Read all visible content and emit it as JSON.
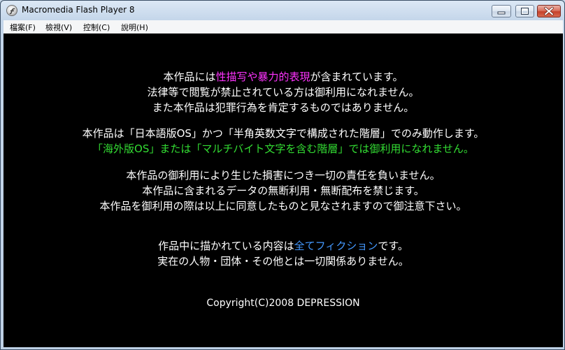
{
  "window": {
    "title": "Macromedia Flash Player 8"
  },
  "menu": {
    "items": [
      "檔案(F)",
      "檢視(V)",
      "控制(C)",
      "說明(H)"
    ]
  },
  "colors": {
    "text": "#ffffff",
    "highlight_magenta": "#ff33ff",
    "highlight_green": "#33dd33",
    "highlight_blue": "#4499ff",
    "stage_background": "#000000"
  },
  "content": {
    "l1_a": "本作品には",
    "l1_b": "性描写や暴力的表現",
    "l1_c": "が含まれています。",
    "l2": "法律等で閲覧が禁止されている方は御利用になれません。",
    "l3": "また本作品は犯罪行為を肯定するものではありません。",
    "l4": "本作品は「日本語版OS」かつ「半角英数文字で構成された階層」でのみ動作します。",
    "l5": "「海外版OS」または「マルチバイト文字を含む階層」では御利用になれません。",
    "l6": "本作品の御利用により生じた損害につき一切の責任を負いません。",
    "l7": "本作品に含まれるデータの無断利用・無断配布を禁じます。",
    "l8": "本作品を御利用の際は以上に同意したものと見なされますので御注意下さい。",
    "l9_a": "作品中に描かれている内容は",
    "l9_b": "全てフィクション",
    "l9_c": "です。",
    "l10": "実在の人物・団体・その他とは一切関係ありません。",
    "copyright": "Copyright(C)2008 DEPRESSION"
  }
}
